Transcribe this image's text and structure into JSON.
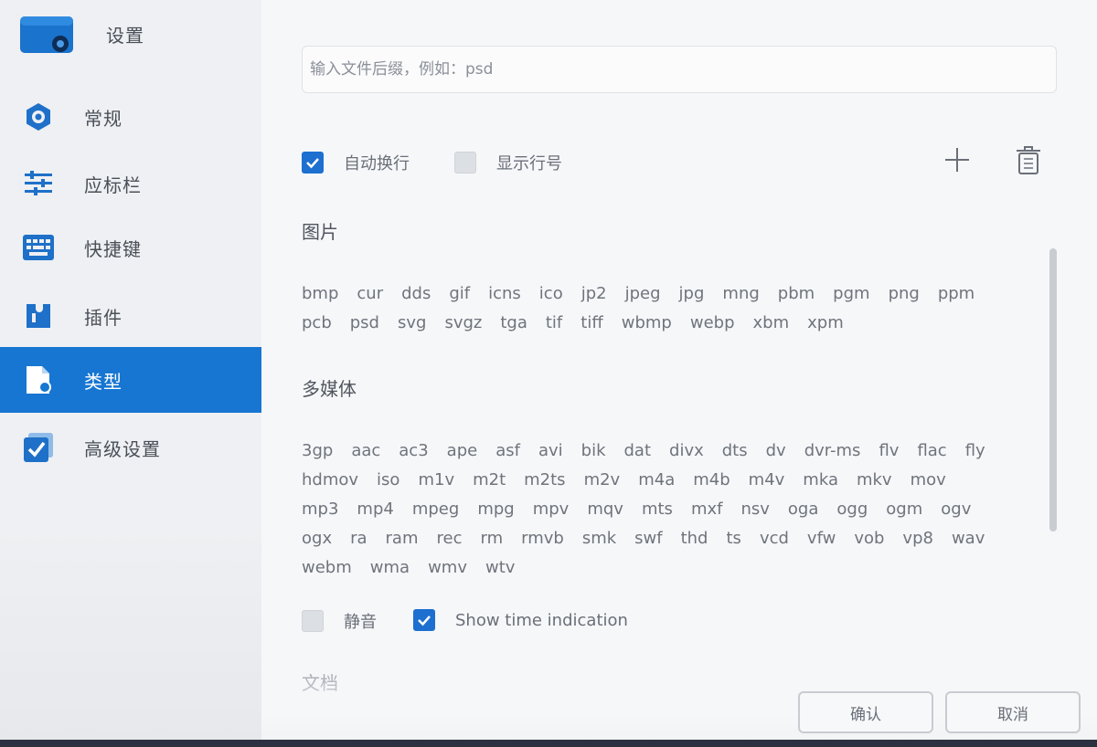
{
  "app": {
    "title": "设置"
  },
  "sidebar": {
    "items": [
      {
        "label": "常规",
        "icon": "gear-icon"
      },
      {
        "label": "应标栏",
        "icon": "sliders-icon"
      },
      {
        "label": "快捷键",
        "icon": "keyboard-icon"
      },
      {
        "label": "插件",
        "icon": "plugin-icon"
      },
      {
        "label": "类型",
        "icon": "file-type-icon",
        "active": true
      },
      {
        "label": "高级设置",
        "icon": "checkbox-icon"
      }
    ]
  },
  "search": {
    "placeholder": "输入文件后缀，例如：psd"
  },
  "options": {
    "auto_wrap": {
      "label": "自动换行",
      "checked": true
    },
    "show_line_numbers": {
      "label": "显示行号",
      "checked": false
    }
  },
  "sections": [
    {
      "title": "图片",
      "extensions": [
        "bmp",
        "cur",
        "dds",
        "gif",
        "icns",
        "ico",
        "jp2",
        "jpeg",
        "jpg",
        "mng",
        "pbm",
        "pgm",
        "png",
        "ppm",
        "pcb",
        "psd",
        "svg",
        "svgz",
        "tga",
        "tif",
        "tiff",
        "wbmp",
        "webp",
        "xbm",
        "xpm"
      ]
    },
    {
      "title": "多媒体",
      "extensions": [
        "3gp",
        "aac",
        "ac3",
        "ape",
        "asf",
        "avi",
        "bik",
        "dat",
        "divx",
        "dts",
        "dv",
        "dvr-ms",
        "flv",
        "flac",
        "fly",
        "hdmov",
        "iso",
        "m1v",
        "m2t",
        "m2ts",
        "m2v",
        "m4a",
        "m4b",
        "m4v",
        "mka",
        "mkv",
        "mov",
        "mp3",
        "mp4",
        "mpeg",
        "mpg",
        "mpv",
        "mqv",
        "mts",
        "mxf",
        "nsv",
        "oga",
        "ogg",
        "ogm",
        "ogv",
        "ogx",
        "ra",
        "ram",
        "rec",
        "rm",
        "rmvb",
        "smk",
        "swf",
        "thd",
        "ts",
        "vcd",
        "vfw",
        "vob",
        "vp8",
        "wav",
        "webm",
        "wma",
        "wmv",
        "wtv"
      ]
    }
  ],
  "media_options": {
    "mute": {
      "label": "静音",
      "checked": false
    },
    "show_time": {
      "label": "Show time indication",
      "checked": true
    }
  },
  "next_section_title": "文档",
  "buttons": {
    "confirm": "确认",
    "cancel": "取消"
  },
  "colors": {
    "accent": "#1676d2",
    "checkbox_on": "#1d6fd0"
  }
}
